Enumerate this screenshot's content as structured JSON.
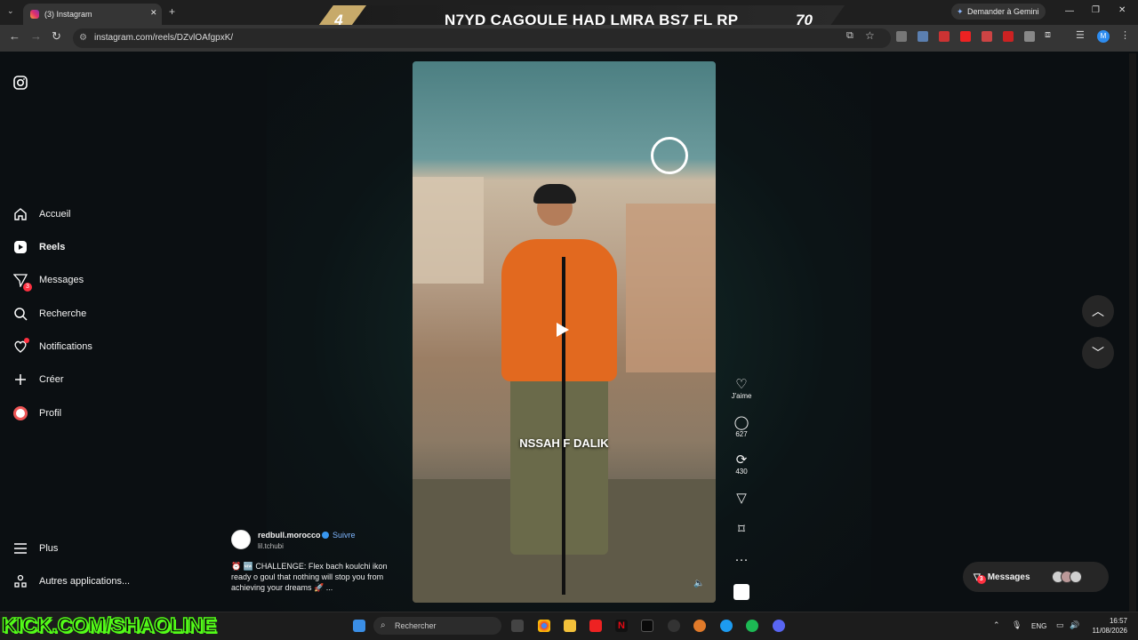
{
  "browser": {
    "tab_title": "(3) Instagram",
    "url": "instagram.com/reels/DZvlOAfgpxK/",
    "gemini_label": "Demander à Gemini",
    "profile_initial": "M"
  },
  "overlay": {
    "rank": "4",
    "title": "N7YD CAGOULE HAD LMRA BS7 FL RP",
    "count": "70",
    "kick_handle": "KICK.COM/SHAOLINE"
  },
  "sidebar": {
    "items": [
      {
        "label": "Accueil",
        "icon": "home-icon"
      },
      {
        "label": "Reels",
        "icon": "reels-icon"
      },
      {
        "label": "Messages",
        "icon": "messages-icon",
        "badge": "3"
      },
      {
        "label": "Recherche",
        "icon": "search-icon"
      },
      {
        "label": "Notifications",
        "icon": "heart-icon"
      },
      {
        "label": "Créer",
        "icon": "plus-icon"
      },
      {
        "label": "Profil",
        "icon": "profile-icon"
      }
    ],
    "more": "Plus",
    "other_apps": "Autres applications..."
  },
  "reel": {
    "caption_overlay": "NSSAH F DALIK",
    "account": "redbull.morocco",
    "follow_label": "Suivre",
    "audio": "lil.tchubi",
    "description": "⏰ 🆕 CHALLENGE: Flex bach koulchi ikon ready o goul that nothing will stop you from achieving your dreams 🚀 ..."
  },
  "actions": {
    "like_label": "J'aime",
    "comments": "627",
    "reposts": "430"
  },
  "messages_pill": {
    "label": "Messages",
    "badge": "3"
  },
  "taskbar": {
    "search_placeholder": "Rechercher",
    "language": "ENG",
    "time": "16:57",
    "date": "11/08/2026"
  }
}
